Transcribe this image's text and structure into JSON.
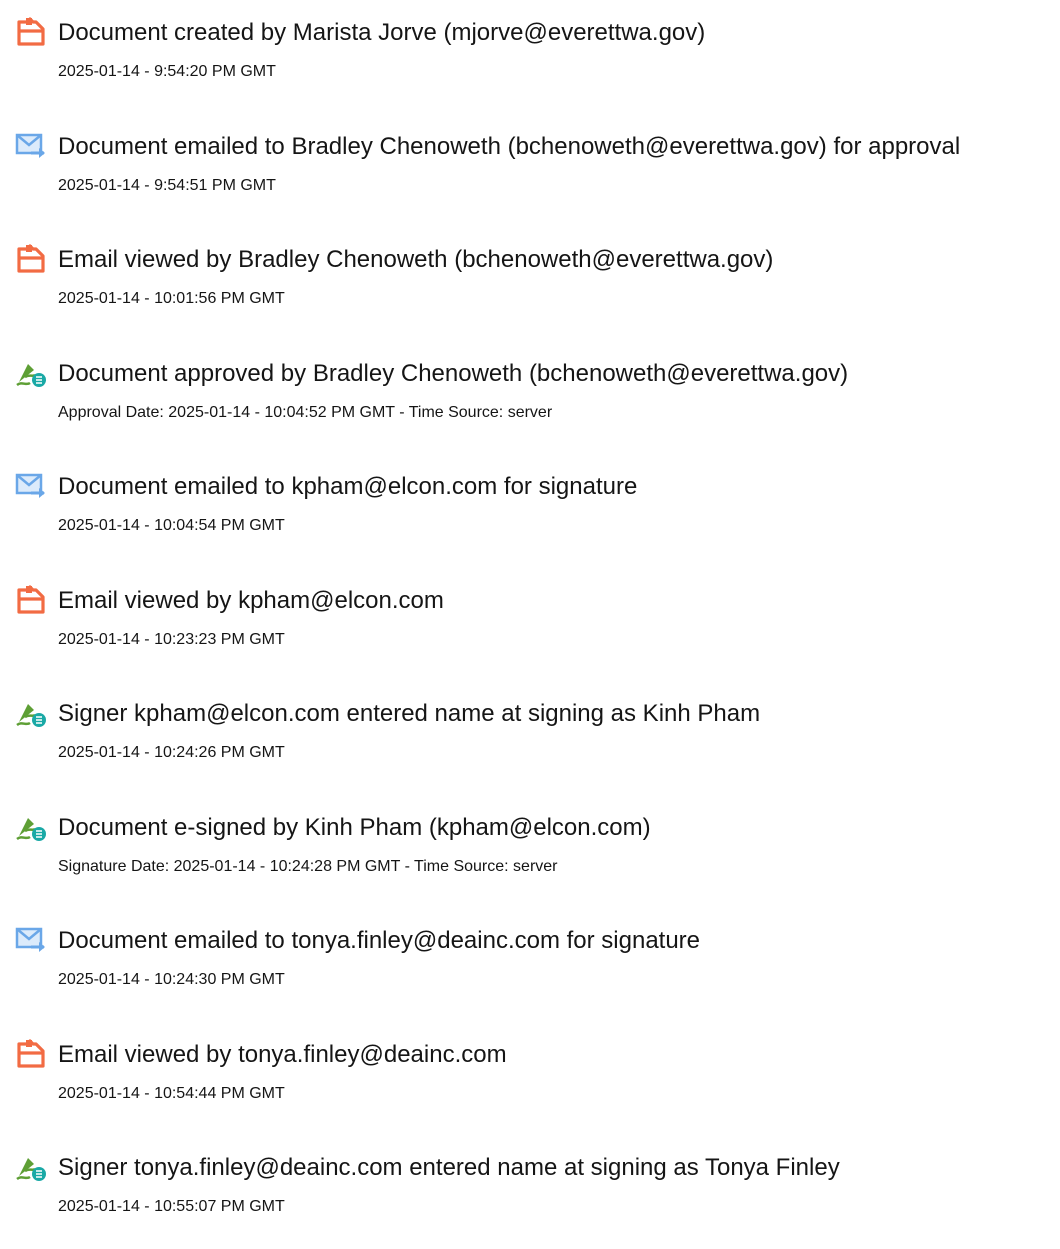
{
  "colors": {
    "document_icon": "#f26b43",
    "email_icon": "#6aa7e8",
    "sign_icon": "#1aa9a6",
    "text": "#151515"
  },
  "events": [
    {
      "icon": "document-icon",
      "title": "Document created by Marista Jorve (mjorve@everettwa.gov)",
      "meta": "2025-01-14 - 9:54:20 PM GMT"
    },
    {
      "icon": "email-icon",
      "title": "Document emailed to Bradley Chenoweth (bchenoweth@everettwa.gov) for approval",
      "meta": "2025-01-14 - 9:54:51 PM GMT"
    },
    {
      "icon": "document-icon",
      "title": "Email viewed by Bradley Chenoweth (bchenoweth@everettwa.gov)",
      "meta": "2025-01-14 - 10:01:56 PM GMT"
    },
    {
      "icon": "sign-icon",
      "title": "Document approved by Bradley Chenoweth (bchenoweth@everettwa.gov)",
      "meta": "Approval Date: 2025-01-14 - 10:04:52 PM GMT - Time Source: server"
    },
    {
      "icon": "email-icon",
      "title": "Document emailed to kpham@elcon.com for signature",
      "meta": "2025-01-14 - 10:04:54 PM GMT"
    },
    {
      "icon": "document-icon",
      "title": "Email viewed by kpham@elcon.com",
      "meta": "2025-01-14 - 10:23:23 PM GMT"
    },
    {
      "icon": "sign-icon",
      "title": "Signer kpham@elcon.com entered name at signing as Kinh Pham",
      "meta": "2025-01-14 - 10:24:26 PM GMT"
    },
    {
      "icon": "sign-icon",
      "title": "Document e-signed by Kinh Pham (kpham@elcon.com)",
      "meta": "Signature Date: 2025-01-14 - 10:24:28 PM GMT - Time Source: server"
    },
    {
      "icon": "email-icon",
      "title": "Document emailed to tonya.finley@deainc.com for signature",
      "meta": "2025-01-14 - 10:24:30 PM GMT"
    },
    {
      "icon": "document-icon",
      "title": "Email viewed by tonya.finley@deainc.com",
      "meta": "2025-01-14 - 10:54:44 PM GMT"
    },
    {
      "icon": "sign-icon",
      "title": "Signer tonya.finley@deainc.com entered name at signing as Tonya Finley",
      "meta": "2025-01-14 - 10:55:07 PM GMT"
    }
  ]
}
